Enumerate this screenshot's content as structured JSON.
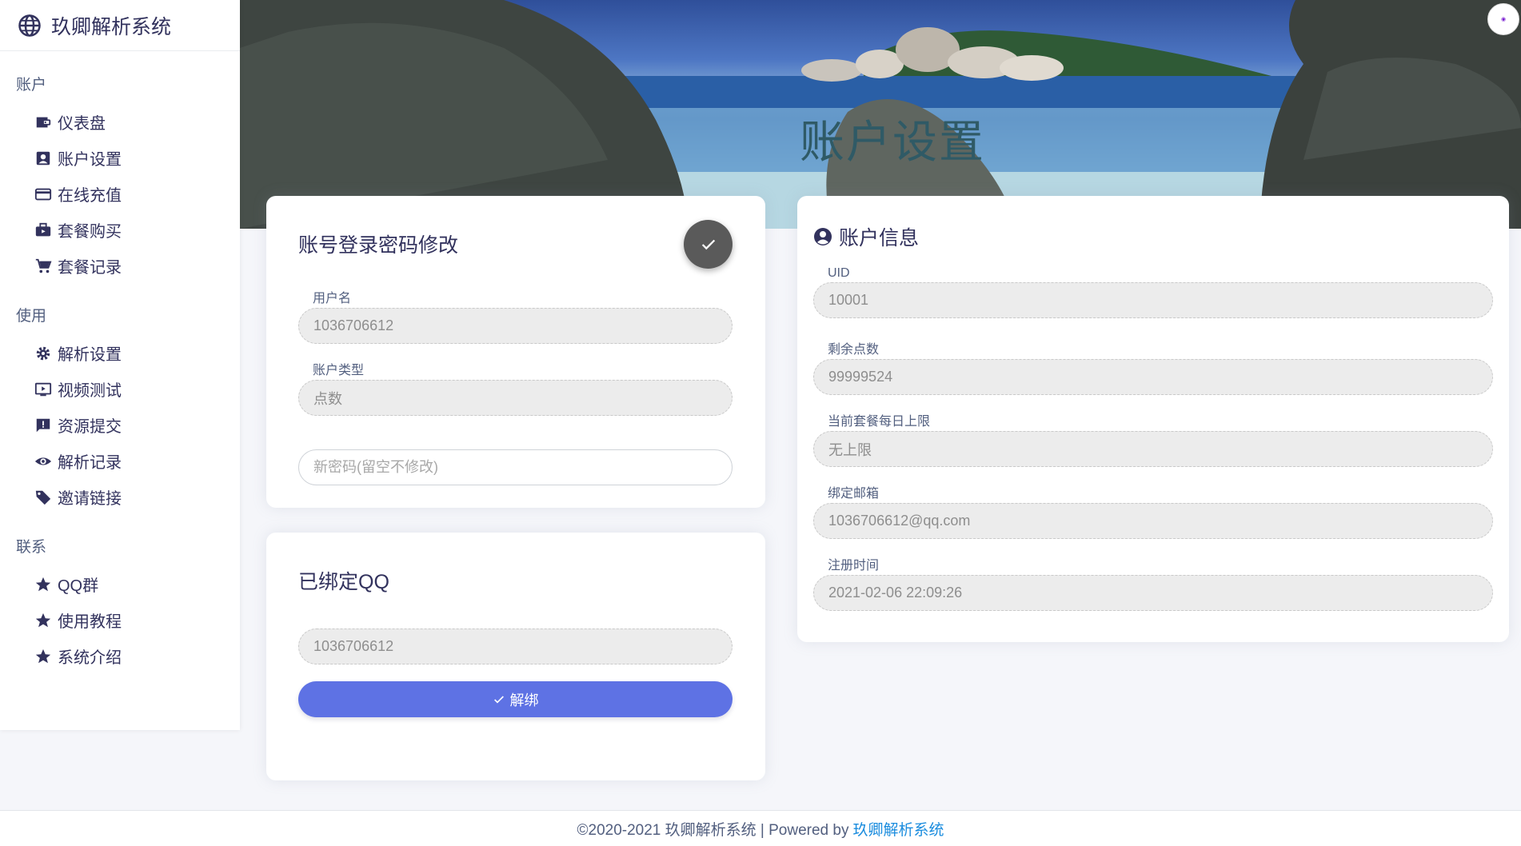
{
  "brand": {
    "name": "玖卿解析系统"
  },
  "hero": {
    "title": "账户设置"
  },
  "sidebar": {
    "sections": [
      {
        "heading": "账户",
        "items": [
          {
            "label": "仪表盘",
            "icon": "wallet-icon"
          },
          {
            "label": "账户设置",
            "icon": "account-box-icon"
          },
          {
            "label": "在线充值",
            "icon": "credit-card-icon"
          },
          {
            "label": "套餐购买",
            "icon": "briefcase-icon"
          },
          {
            "label": "套餐记录",
            "icon": "cart-icon"
          }
        ]
      },
      {
        "heading": "使用",
        "items": [
          {
            "label": "解析设置",
            "icon": "gear-icon"
          },
          {
            "label": "视频测试",
            "icon": "play-icon"
          },
          {
            "label": "资源提交",
            "icon": "feedback-icon"
          },
          {
            "label": "解析记录",
            "icon": "eye-icon"
          },
          {
            "label": "邀请链接",
            "icon": "tag-icon"
          }
        ]
      },
      {
        "heading": "联系",
        "items": [
          {
            "label": "QQ群",
            "icon": "star-icon"
          },
          {
            "label": "使用教程",
            "icon": "star-icon"
          },
          {
            "label": "系统介绍",
            "icon": "star-icon"
          }
        ]
      }
    ]
  },
  "password_card": {
    "title": "账号登录密码修改",
    "username_label": "用户名",
    "username_value": "1036706612",
    "type_label": "账户类型",
    "type_value": "点数",
    "new_password_placeholder": "新密码(留空不修改)"
  },
  "qq_card": {
    "title": "已绑定QQ",
    "qq_value": "1036706612",
    "unbind_label": "解绑"
  },
  "account_card": {
    "title": "账户信息",
    "fields": [
      {
        "label": "UID",
        "value": "10001"
      },
      {
        "label": "剩余点数",
        "value": "99999524"
      },
      {
        "label": "当前套餐每日上限",
        "value": "无上限"
      },
      {
        "label": "绑定邮箱",
        "value": "1036706612@qq.com"
      },
      {
        "label": "注册时间",
        "value": "2021-02-06 22:09:26"
      }
    ]
  },
  "footer": {
    "copyright": "©2020-2021 玖卿解析系统 | Powered by",
    "link": "玖卿解析系统"
  },
  "colors": {
    "primary": "#5e72e4",
    "heading": "#32325d",
    "link": "#1a8cde"
  }
}
